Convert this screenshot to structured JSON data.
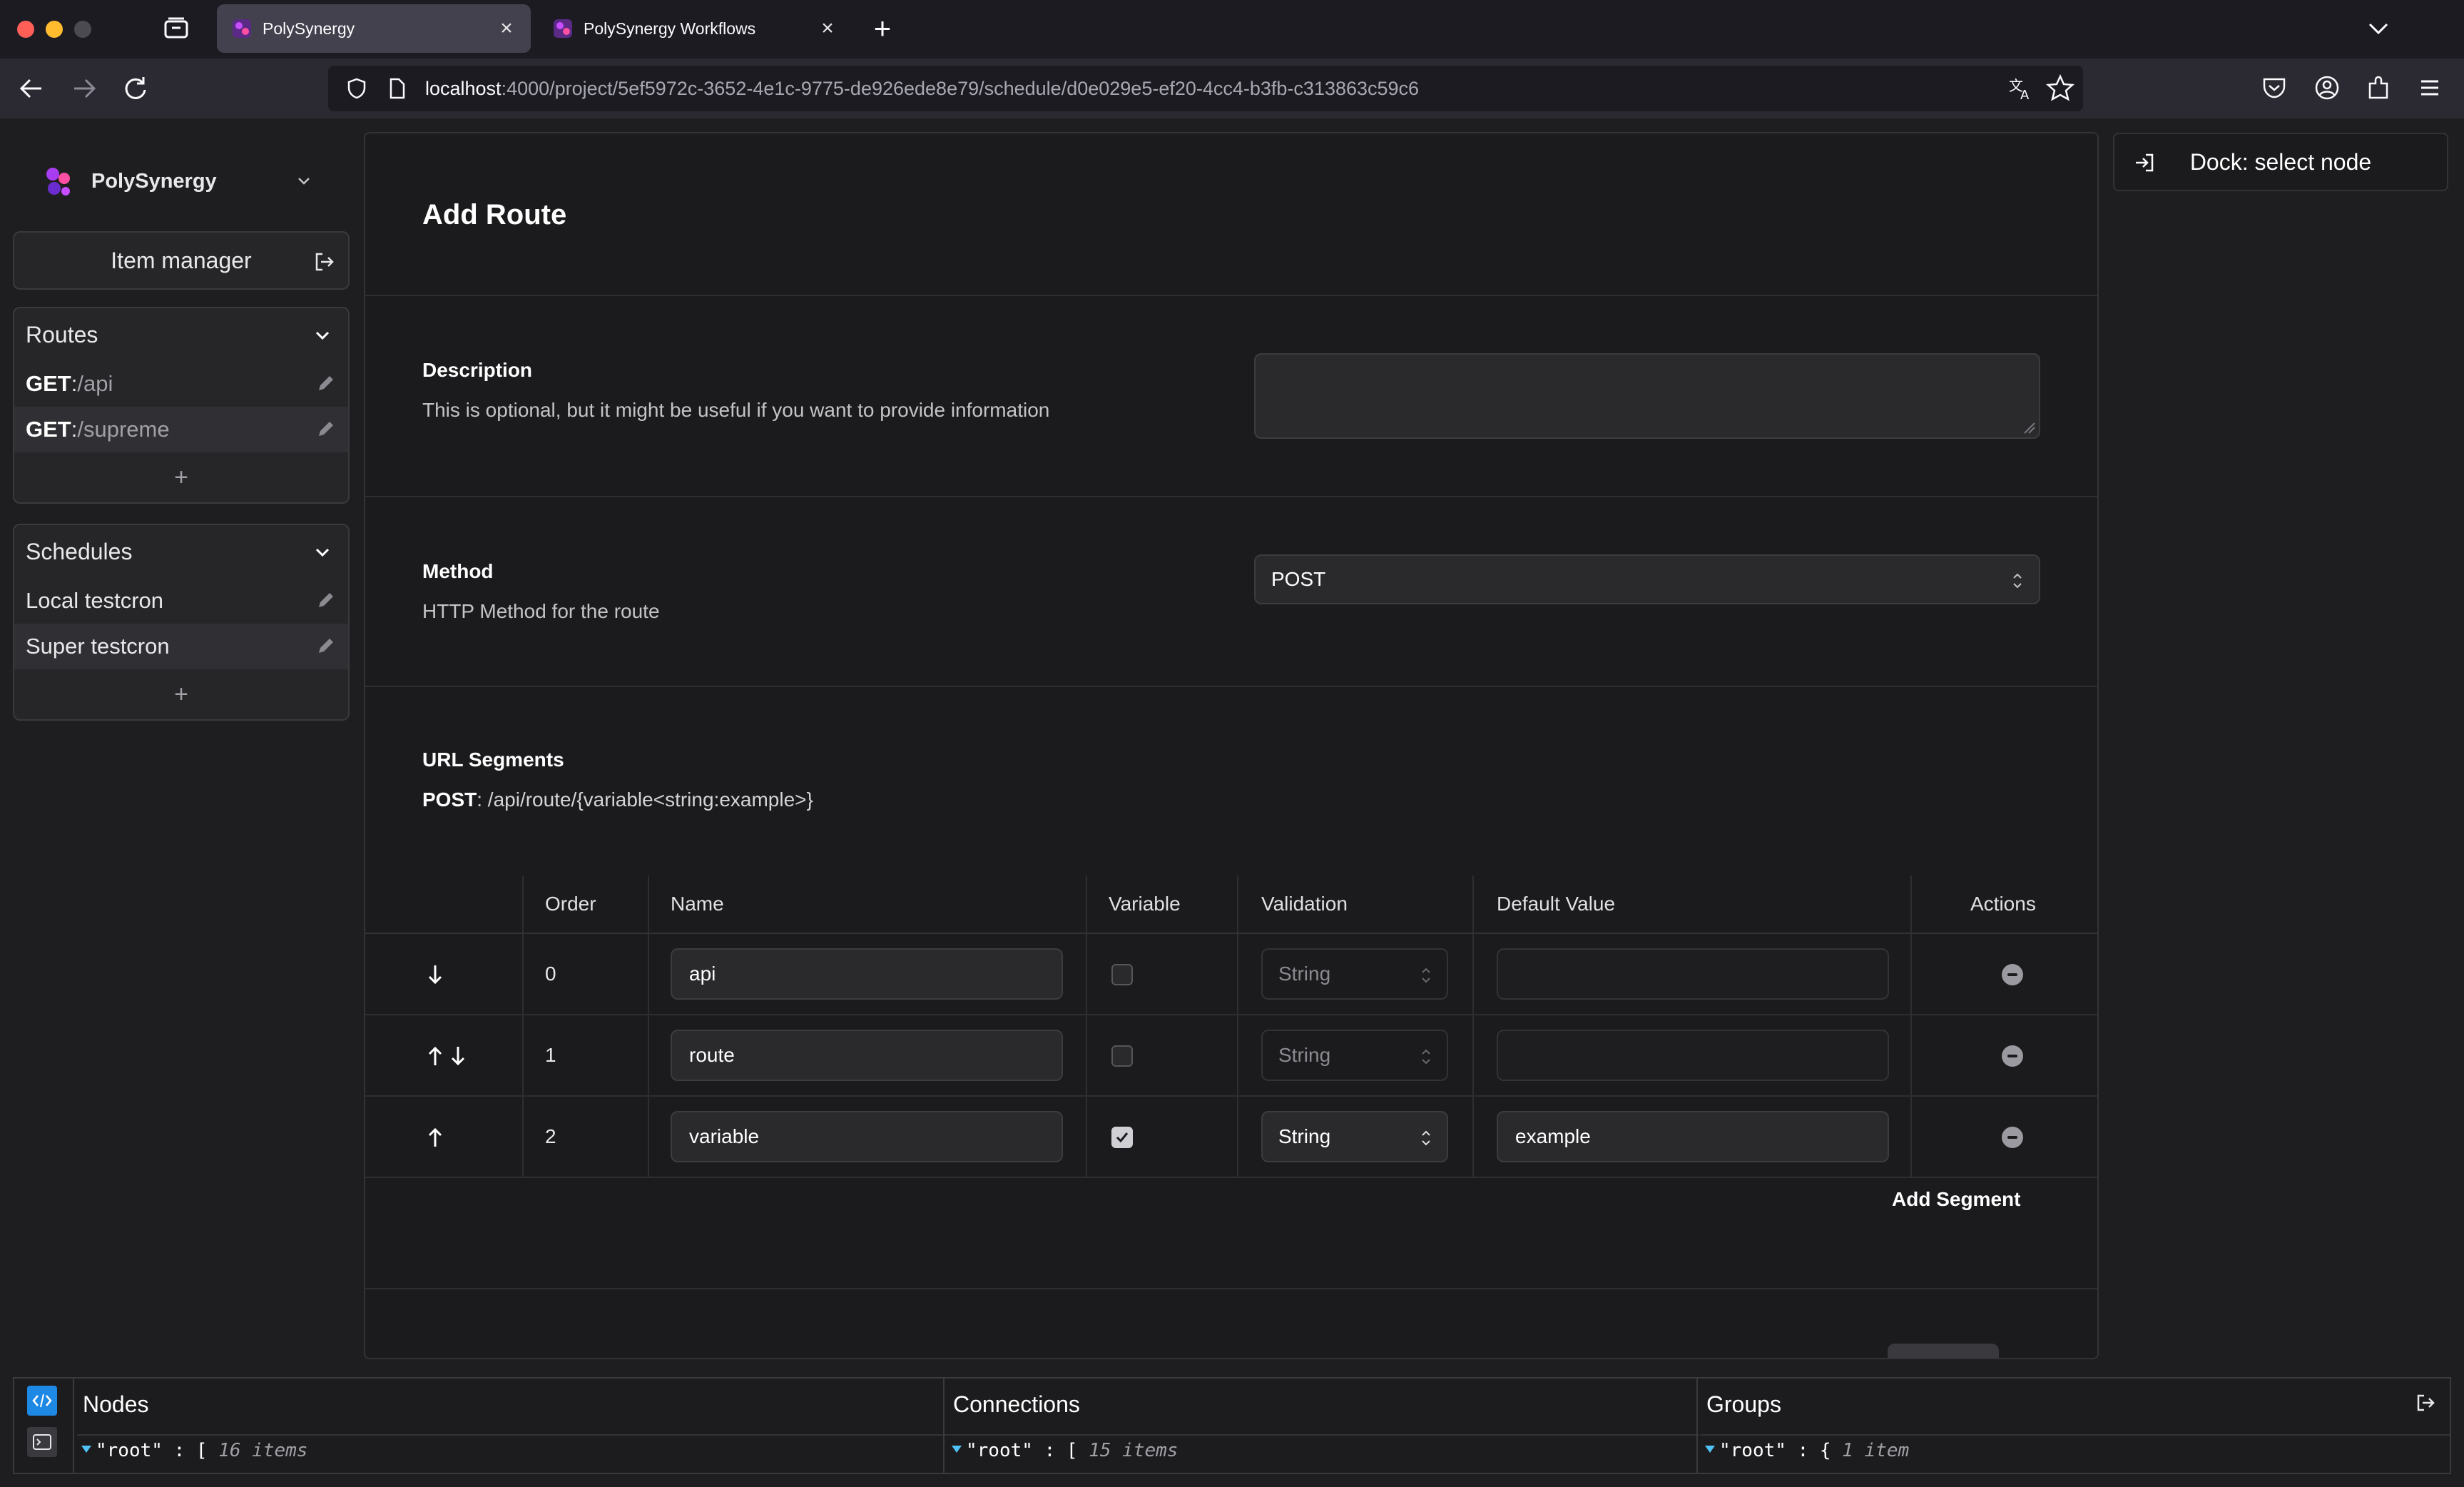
{
  "browser": {
    "tabs": [
      {
        "title": "PolySynergy",
        "active": true
      },
      {
        "title": "PolySynergy Workflows",
        "active": false
      }
    ],
    "url_host": "localhost",
    "url_rest": ":4000/project/5ef5972c-3652-4e1c-9775-de926ede8e79/schedule/d0e029e5-ef20-4cc4-b3fb-c313863c59c6"
  },
  "sidebar": {
    "brand": "PolySynergy",
    "item_manager": "Item manager",
    "routes": {
      "title": "Routes",
      "items": [
        {
          "method": "GET",
          "sep": ": ",
          "path": "/api"
        },
        {
          "method": "GET",
          "sep": ": ",
          "path": "/supreme"
        }
      ],
      "add": "+"
    },
    "schedules": {
      "title": "Schedules",
      "items": [
        {
          "label": "Local testcron"
        },
        {
          "label": "Super testcron"
        }
      ],
      "add": "+"
    }
  },
  "form": {
    "title": "Add Route",
    "description": {
      "label": "Description",
      "help": "This is optional, but it might be useful if you want to provide information",
      "value": ""
    },
    "method": {
      "label": "Method",
      "help": "HTTP Method for the route",
      "value": "POST"
    },
    "url_segments": {
      "label": "URL Segments",
      "preview_method": "POST",
      "preview_path": ": /api/route/{variable<string:example>}"
    },
    "table": {
      "headers": [
        "Order",
        "Name",
        "Variable",
        "Validation",
        "Default Value",
        "Actions"
      ],
      "rows": [
        {
          "order": "0",
          "name": "api",
          "variable": false,
          "validation": "String",
          "default": ""
        },
        {
          "order": "1",
          "name": "route",
          "variable": false,
          "validation": "String",
          "default": ""
        },
        {
          "order": "2",
          "name": "variable",
          "variable": true,
          "validation": "String",
          "default": "example"
        }
      ]
    },
    "add_segment": "Add Segment"
  },
  "dock": {
    "label": "Dock: select node"
  },
  "debug": {
    "columns": [
      {
        "title": "Nodes",
        "key": "\"root\"",
        "bracket": ": [",
        "count": "16 items"
      },
      {
        "title": "Connections",
        "key": "\"root\"",
        "bracket": ": [",
        "count": "15 items"
      },
      {
        "title": "Groups",
        "key": "\"root\"",
        "bracket": ": {",
        "count": "1 item"
      }
    ]
  },
  "colors": {
    "accent": "#1e88e5",
    "brand_purple": "#8e2de2",
    "bg": "#1e1e20"
  }
}
